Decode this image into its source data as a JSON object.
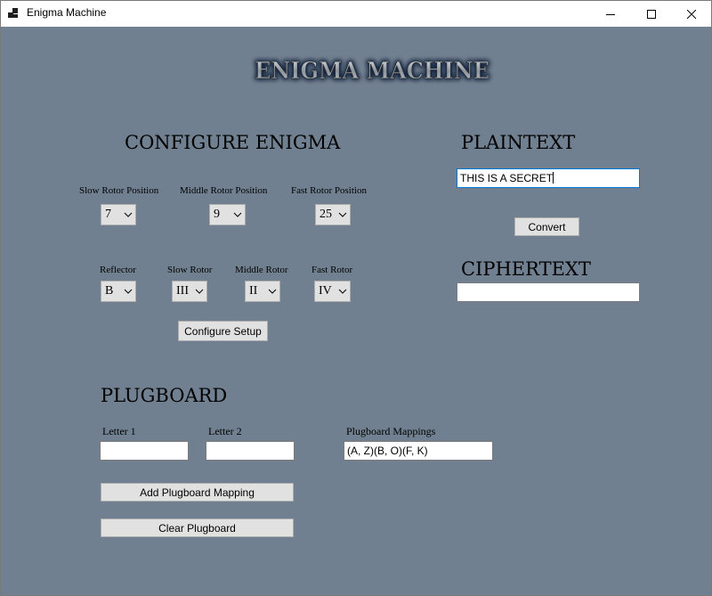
{
  "window": {
    "title": "Enigma Machine"
  },
  "logo": {
    "text": "ENIGMA MACHINE"
  },
  "configure": {
    "heading": "CONFIGURE ENIGMA",
    "slow_pos_label": "Slow Rotor Position",
    "middle_pos_label": "Middle Rotor Position",
    "fast_pos_label": "Fast Rotor Position",
    "slow_pos_value": "7",
    "middle_pos_value": "9",
    "fast_pos_value": "25",
    "reflector_label": "Reflector",
    "slow_rotor_label": "Slow Rotor",
    "middle_rotor_label": "Middle Rotor",
    "fast_rotor_label": "Fast Rotor",
    "reflector_value": "B",
    "slow_rotor_value": "III",
    "middle_rotor_value": "II",
    "fast_rotor_value": "IV",
    "setup_button": "Configure Setup"
  },
  "plaintext": {
    "heading": "PLAINTEXT",
    "value": "THIS IS A SECRET",
    "convert_button": "Convert"
  },
  "ciphertext": {
    "heading": "CIPHERTEXT",
    "value": ""
  },
  "plugboard": {
    "heading": "PLUGBOARD",
    "letter1_label": "Letter 1",
    "letter2_label": "Letter 2",
    "mappings_label": "Plugboard Mappings",
    "letter1_value": "",
    "letter2_value": "",
    "mappings_value": "(A, Z)(B, O)(F, K)",
    "add_button": "Add Plugboard Mapping",
    "clear_button": "Clear Plugboard"
  },
  "colors": {
    "client_background": "#708090",
    "control_face": "#e1e1e1",
    "focus_border": "#0078d7"
  },
  "icons": [
    "app-icon",
    "minimize-icon",
    "maximize-icon",
    "close-icon",
    "chevron-down-icon"
  ]
}
